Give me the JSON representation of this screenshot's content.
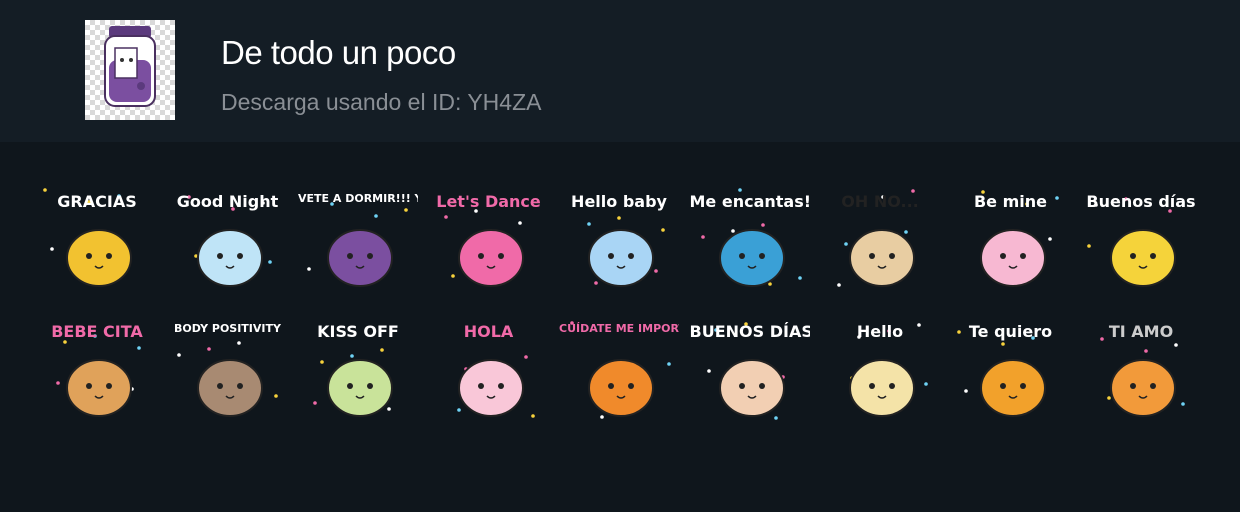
{
  "pack": {
    "title": "De todo un poco",
    "subtitle": "Descarga usando el ID: YH4ZA",
    "thumbnail_icon": "grape-jam-jar-icon"
  },
  "stickers": [
    {
      "id": "gracias-bee",
      "caption": "GRACIAS",
      "icon": "bee-icon",
      "color": "#f2c230"
    },
    {
      "id": "good-night-cloud",
      "caption": "Good Night",
      "icon": "sleeping-cloud-icon",
      "color": "#bfe4f7"
    },
    {
      "id": "vete-a-dormir-jar",
      "caption": "VETE A DORMIR!!! YAAAAA...",
      "icon": "grape-jam-jar-icon",
      "color": "#7b4fa0"
    },
    {
      "id": "lets-dance",
      "caption": "Let's Dance",
      "icon": "girl-frog-hoodie-icon",
      "color": "#f06aa8"
    },
    {
      "id": "hello-baby-bunny",
      "caption": "Hello baby",
      "icon": "bunny-icon",
      "color": "#a9d5f5"
    },
    {
      "id": "me-encantas-earth",
      "caption": "Me encantas!",
      "icon": "earth-icon",
      "color": "#3aa0d6"
    },
    {
      "id": "oh-no-cat",
      "caption": "OH NO...",
      "icon": "cat-icon",
      "color": "#e8cda2"
    },
    {
      "id": "be-mine-unicorn",
      "caption": "Be mine",
      "icon": "unicorn-icon",
      "color": "#f7b8d2"
    },
    {
      "id": "buenos-dias-chick",
      "caption": "Buenos días",
      "icon": "chick-icon",
      "color": "#f5d33a"
    },
    {
      "id": "bebe-cita-tiger",
      "caption": "BEBE CITA",
      "icon": "tiger-costume-girl-icon",
      "color": "#e0a25a"
    },
    {
      "id": "body-positivity-sloth",
      "caption": "BODY POSITIVITY",
      "icon": "sloth-icon",
      "color": "#a88a72"
    },
    {
      "id": "kiss-off-dino",
      "caption": "KISS OFF",
      "icon": "dinosaur-icon",
      "color": "#c9e39a"
    },
    {
      "id": "hola-cloud",
      "caption": "HOLA",
      "icon": "rainbow-cloud-icon",
      "color": "#f9c7d8"
    },
    {
      "id": "cuidate-cat",
      "caption": "CUÍDATE ME IMPORTAS...",
      "icon": "orange-cat-icon",
      "color": "#f08a2b"
    },
    {
      "id": "buenos-dias-girl",
      "caption": "BUENOS DÍAS!!",
      "icon": "girl-face-icon",
      "color": "#f2cfb3"
    },
    {
      "id": "hello-girl",
      "caption": "Hello",
      "icon": "blonde-girl-icon",
      "color": "#f4e3a8"
    },
    {
      "id": "te-quiero-bear",
      "caption": "Te quiero",
      "icon": "bear-costume-boy-icon",
      "color": "#f2a12b"
    },
    {
      "id": "ti-amo-cat",
      "caption": "TI AMO",
      "icon": "lying-cat-icon",
      "color": "#f29a3a"
    }
  ]
}
